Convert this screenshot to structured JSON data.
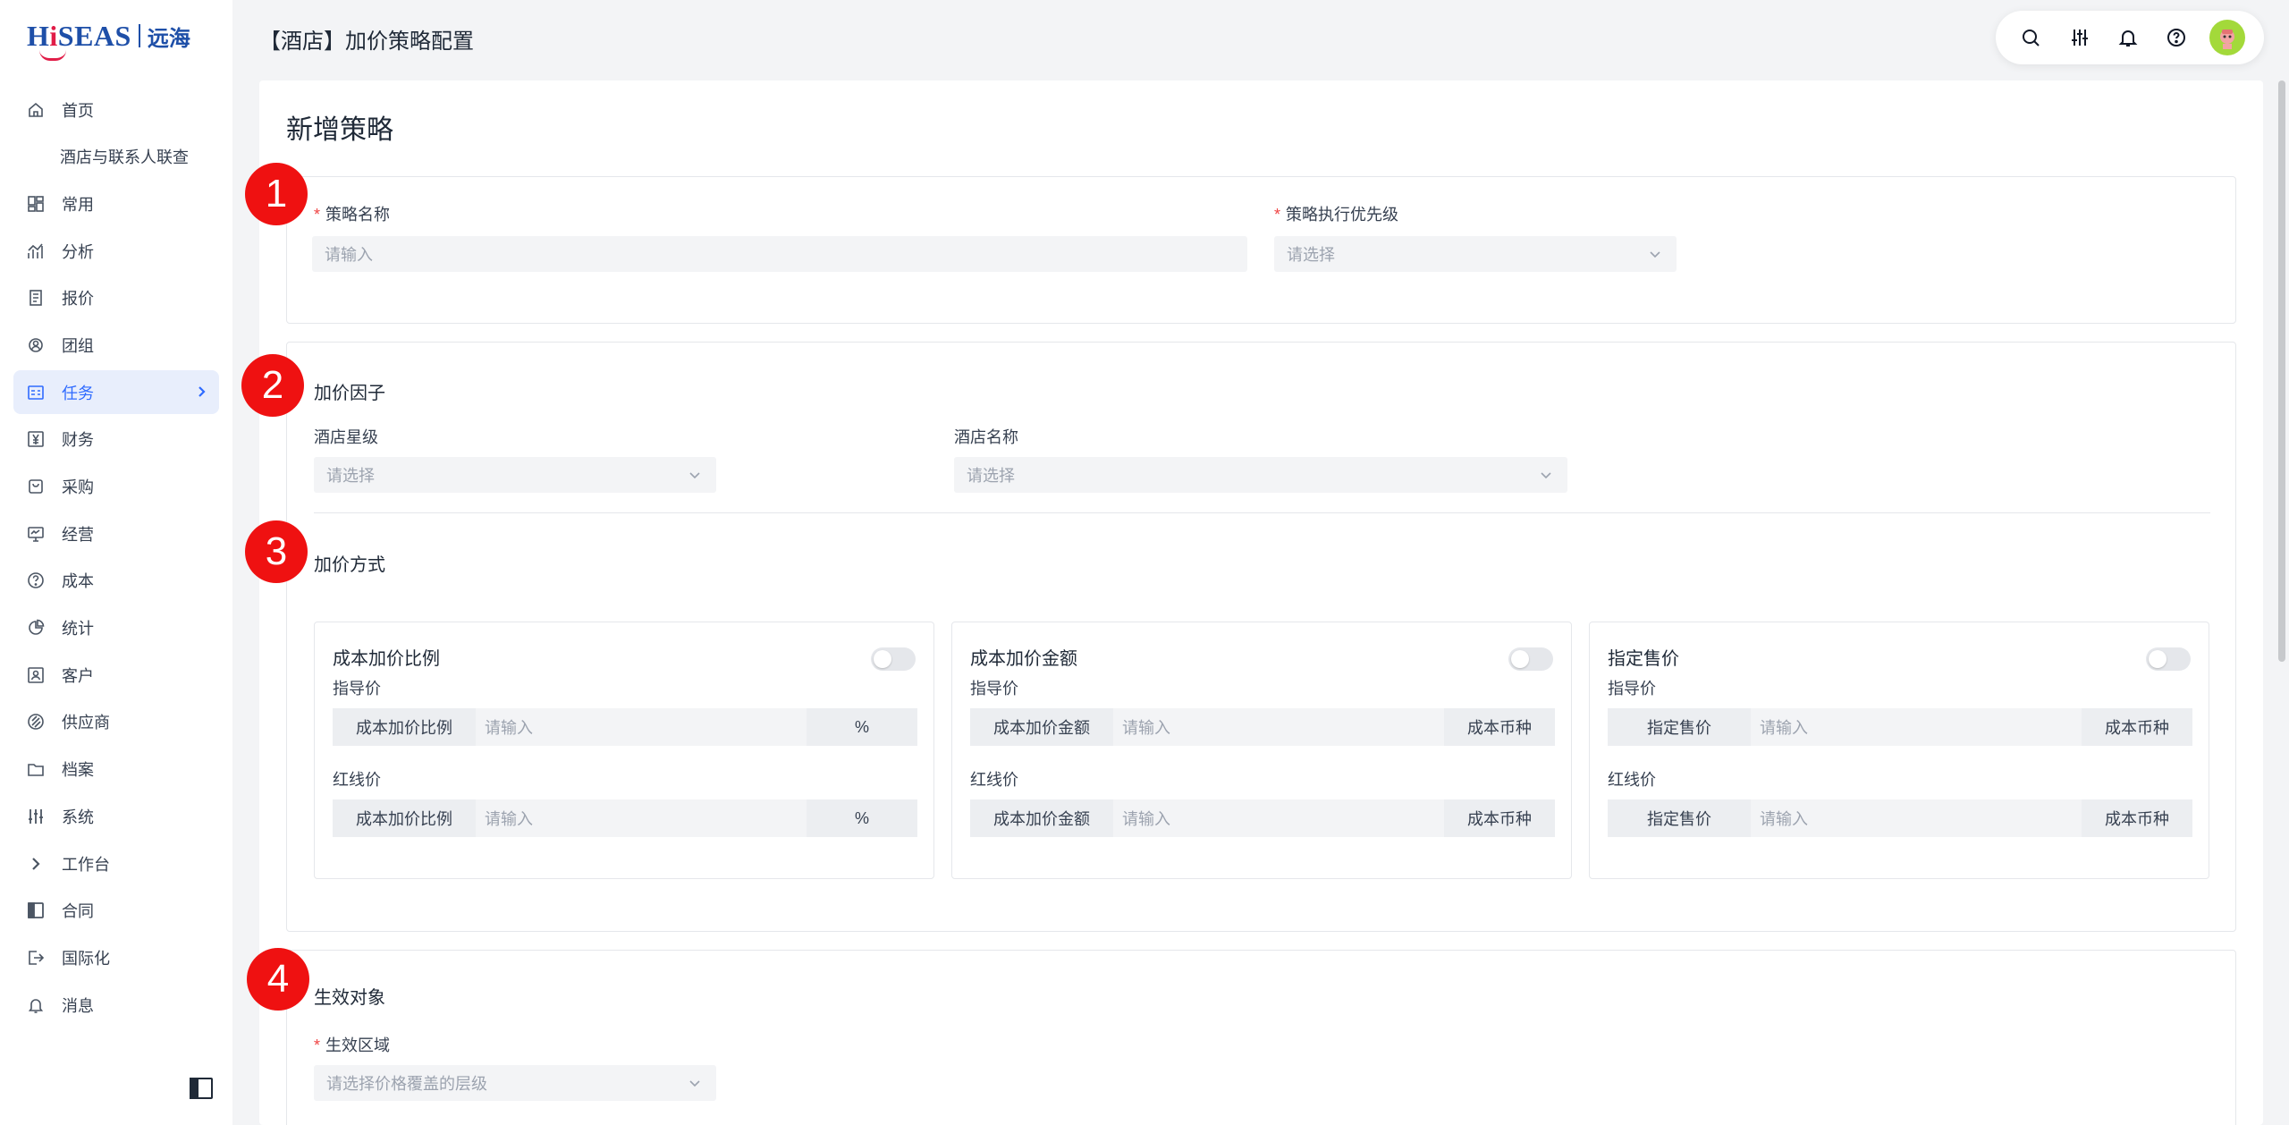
{
  "brand": {
    "name_en": "HiSEAS",
    "name_cn": "远海"
  },
  "sidebar": {
    "items": [
      {
        "label": "首页",
        "icon": "home-icon"
      },
      {
        "label": "酒店与联系人联查",
        "icon": ""
      },
      {
        "label": "常用",
        "icon": "dashboard-icon"
      },
      {
        "label": "分析",
        "icon": "analytics-icon"
      },
      {
        "label": "报价",
        "icon": "document-icon"
      },
      {
        "label": "团组",
        "icon": "group-icon"
      },
      {
        "label": "任务",
        "icon": "task-icon",
        "active": true
      },
      {
        "label": "财务",
        "icon": "yen-icon"
      },
      {
        "label": "采购",
        "icon": "bag-icon"
      },
      {
        "label": "经营",
        "icon": "monitor-icon"
      },
      {
        "label": "成本",
        "icon": "help-circle-icon"
      },
      {
        "label": "统计",
        "icon": "pie-chart-icon"
      },
      {
        "label": "客户",
        "icon": "contact-icon"
      },
      {
        "label": "供应商",
        "icon": "supplier-icon"
      },
      {
        "label": "档案",
        "icon": "folder-icon"
      },
      {
        "label": "系统",
        "icon": "sliders-icon"
      },
      {
        "label": "工作台",
        "icon": "chevron-right-icon"
      },
      {
        "label": "合同",
        "icon": "contract-icon"
      },
      {
        "label": "国际化",
        "icon": "logout-icon"
      },
      {
        "label": "消息",
        "icon": "bell-icon"
      }
    ]
  },
  "header": {
    "title": "【酒店】加价策略配置"
  },
  "form": {
    "title": "新增策略",
    "badges": [
      "1",
      "2",
      "3",
      "4"
    ],
    "basic": {
      "name_label": "策略名称",
      "name_placeholder": "请输入",
      "priority_label": "策略执行优先级",
      "priority_placeholder": "请选择"
    },
    "factors": {
      "heading": "加价因子",
      "star_label": "酒店星级",
      "star_placeholder": "请选择",
      "hotel_label": "酒店名称",
      "hotel_placeholder": "请选择"
    },
    "methods": {
      "heading": "加价方式",
      "cards": [
        {
          "title": "成本加价比例",
          "guide_label": "指导价",
          "red_label": "红线价",
          "prefix": "成本加价比例",
          "placeholder": "请输入",
          "suffix": "%",
          "enabled": false
        },
        {
          "title": "成本加价金额",
          "guide_label": "指导价",
          "red_label": "红线价",
          "prefix": "成本加价金额",
          "placeholder": "请输入",
          "suffix": "成本币种",
          "enabled": false
        },
        {
          "title": "指定售价",
          "guide_label": "指导价",
          "red_label": "红线价",
          "prefix": "指定售价",
          "placeholder": "请输入",
          "suffix": "成本币种",
          "enabled": false
        }
      ]
    },
    "target": {
      "heading": "生效对象",
      "region_label": "生效区域",
      "region_placeholder": "请选择价格覆盖的层级"
    }
  }
}
